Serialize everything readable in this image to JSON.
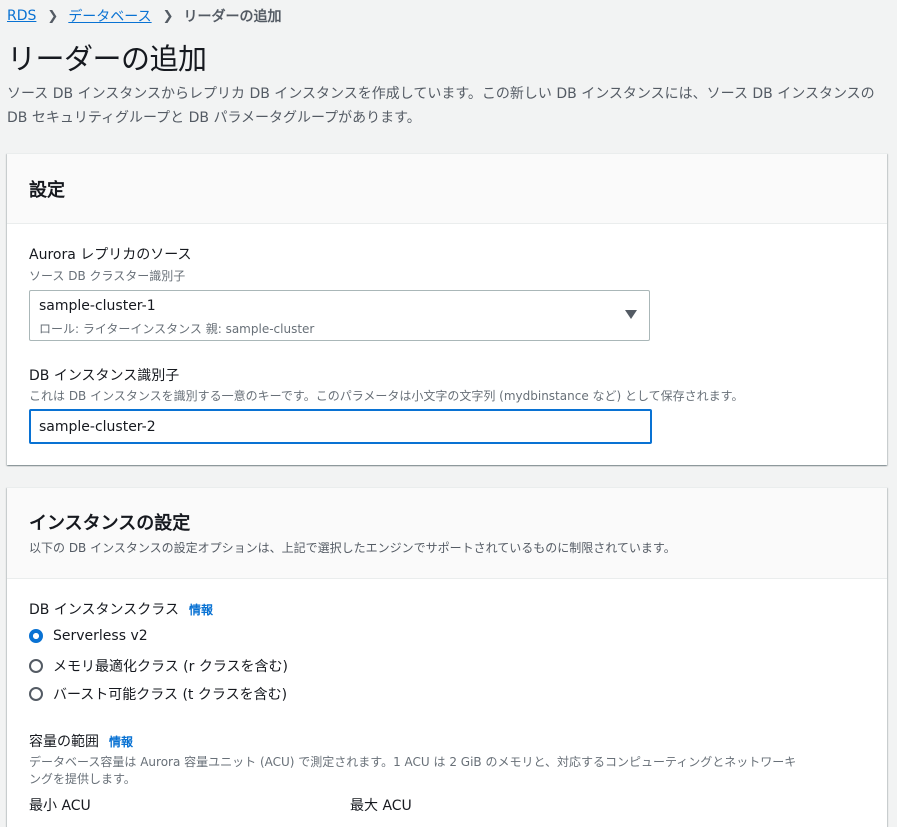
{
  "breadcrumb": {
    "items": [
      "RDS",
      "データベース"
    ],
    "current": "リーダーの追加"
  },
  "page": {
    "title": "リーダーの追加",
    "description": "ソース DB インスタンスからレプリカ DB インスタンスを作成しています。この新しい DB インスタンスには、ソース DB インスタンスの DB セキュリティグループと DB パラメータグループがあります。"
  },
  "settings": {
    "title": "設定",
    "source": {
      "label": "Aurora レプリカのソース",
      "description": "ソース DB クラスター識別子",
      "selected_value": "sample-cluster-1",
      "selected_meta": "ロール: ライターインスタンス 親: sample-cluster"
    },
    "identifier": {
      "label": "DB インスタンス識別子",
      "description": "これは DB インスタンスを識別する一意のキーです。このパラメータは小文字の文字列 (mydbinstance など) として保存されます。",
      "value": "sample-cluster-2"
    }
  },
  "instance": {
    "title": "インスタンスの設定",
    "subtitle": "以下の DB インスタンスの設定オプションは、上記で選択したエンジンでサポートされているものに制限されています。",
    "class_label": "DB インスタンスクラス",
    "info": "情報",
    "options": [
      {
        "label": "Serverless v2",
        "selected": true
      },
      {
        "label": "メモリ最適化クラス (r クラスを含む)",
        "selected": false
      },
      {
        "label": "バースト可能クラス (t クラスを含む)",
        "selected": false
      }
    ],
    "capacity": {
      "label": "容量の範囲",
      "info": "情報",
      "description_line1": "データベース容量は Aurora 容量ユニット (ACU) で測定されます。1 ACU は 2 GiB のメモリと、対応するコンピューティングとネットワーキ",
      "description_line2": "ングを提供します。",
      "min_label": "最小 ACU",
      "max_label": "最大 ACU"
    }
  },
  "colors": {
    "link": "#0972d3",
    "background": "#f2f3f3",
    "panel_header": "#fafafa"
  }
}
